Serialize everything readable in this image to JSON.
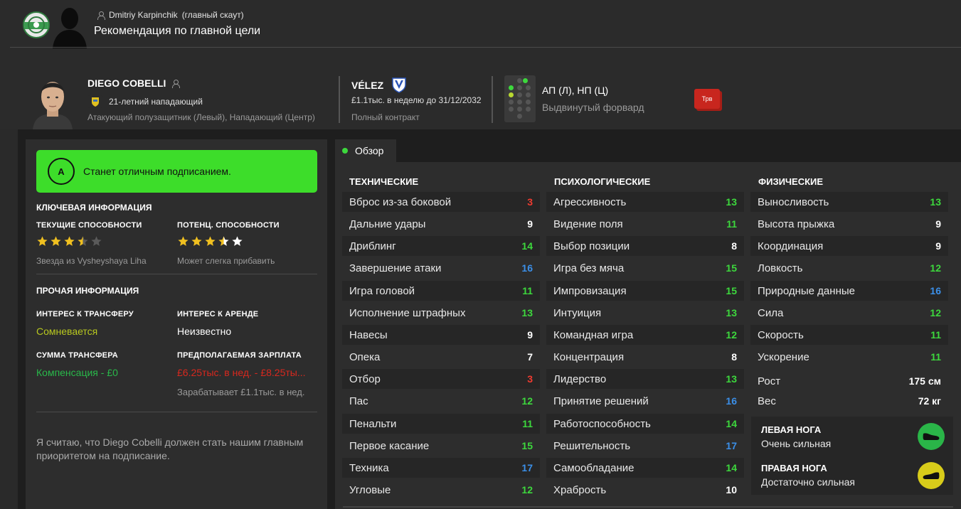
{
  "scout": {
    "name": "Dmitriy Karpinchik",
    "role": "(главный скаут)"
  },
  "page_title": "Рекомендация по главной цели",
  "player": {
    "name": "DIEGO COBELLI",
    "age_line": "21-летний нападающий",
    "positions": "Атакующий полузащитник (Левый), Нападающий (Центр)"
  },
  "club": {
    "name": "VÉLEZ",
    "contract": "£1.1тыс. в неделю до 31/12/2032",
    "contract_type": "Полный контракт"
  },
  "role": {
    "positions": "АП (Л), НП (Ц)",
    "name": "Выдвинутый форвард"
  },
  "injury_badge": "Трв",
  "grade": {
    "letter": "A",
    "text": "Станет отличным подписанием.",
    "color": "#3ddd2a"
  },
  "key_info": {
    "title": "КЛЮЧЕВАЯ ИНФОРМАЦИЯ",
    "current_label": "ТЕКУЩИЕ СПОСОБНОСТИ",
    "current_stars": 3.5,
    "current_note": "Звезда из Vysheyshaya Liha",
    "potential_label": "ПОТЕНЦ. СПОСОБНОСТИ",
    "potential_stars": 3.5,
    "potential_extra_stars": 1,
    "potential_note": "Может слегка прибавить"
  },
  "other_info": {
    "title": "ПРОЧАЯ ИНФОРМАЦИЯ",
    "transfer_interest_label": "ИНТЕРЕС К ТРАНСФЕРУ",
    "transfer_interest_value": "Сомневается",
    "loan_interest_label": "ИНТЕРЕС К АРЕНДЕ",
    "loan_interest_value": "Неизвестно",
    "fee_label": "СУММА ТРАНСФЕРА",
    "fee_value": "Компенсация - £0",
    "wage_label": "ПРЕДПОЛАГАЕМАЯ ЗАРПЛАТА",
    "wage_value": "£6.25тыс. в нед. - £8.25ты...",
    "current_wage": "Зарабатывает £1.1тыс. в нед."
  },
  "comment": "Я считаю, что Diego Cobelli должен стать нашим главным приоритетом на подписание.",
  "tab": {
    "label": "Обзор"
  },
  "columns": {
    "technical": {
      "title": "ТЕХНИЧЕСКИЕ",
      "rows": [
        {
          "name": "Вброс из-за боковой",
          "value": "3",
          "tone": "red"
        },
        {
          "name": "Дальние удары",
          "value": "9",
          "tone": "white"
        },
        {
          "name": "Дриблинг",
          "value": "14",
          "tone": "green"
        },
        {
          "name": "Завершение атаки",
          "value": "16",
          "tone": "blue"
        },
        {
          "name": "Игра головой",
          "value": "11",
          "tone": "green"
        },
        {
          "name": "Исполнение штрафных",
          "value": "13",
          "tone": "green"
        },
        {
          "name": "Навесы",
          "value": "9",
          "tone": "white"
        },
        {
          "name": "Опека",
          "value": "7",
          "tone": "white"
        },
        {
          "name": "Отбор",
          "value": "3",
          "tone": "red"
        },
        {
          "name": "Пас",
          "value": "12",
          "tone": "green"
        },
        {
          "name": "Пенальти",
          "value": "11",
          "tone": "green"
        },
        {
          "name": "Первое касание",
          "value": "15",
          "tone": "green"
        },
        {
          "name": "Техника",
          "value": "17",
          "tone": "blue"
        },
        {
          "name": "Угловые",
          "value": "12",
          "tone": "green"
        }
      ]
    },
    "mental": {
      "title": "ПСИХОЛОГИЧЕСКИЕ",
      "rows": [
        {
          "name": "Агрессивность",
          "value": "13",
          "tone": "green"
        },
        {
          "name": "Видение поля",
          "value": "11",
          "tone": "green"
        },
        {
          "name": "Выбор позиции",
          "value": "8",
          "tone": "white"
        },
        {
          "name": "Игра без мяча",
          "value": "15",
          "tone": "green"
        },
        {
          "name": "Импровизация",
          "value": "15",
          "tone": "green"
        },
        {
          "name": "Интуиция",
          "value": "13",
          "tone": "green"
        },
        {
          "name": "Командная игра",
          "value": "12",
          "tone": "green"
        },
        {
          "name": "Концентрация",
          "value": "8",
          "tone": "white"
        },
        {
          "name": "Лидерство",
          "value": "13",
          "tone": "green"
        },
        {
          "name": "Принятие решений",
          "value": "16",
          "tone": "blue"
        },
        {
          "name": "Работоспособность",
          "value": "14",
          "tone": "green"
        },
        {
          "name": "Решительность",
          "value": "17",
          "tone": "blue"
        },
        {
          "name": "Самообладание",
          "value": "14",
          "tone": "green"
        },
        {
          "name": "Храбрость",
          "value": "10",
          "tone": "white"
        }
      ]
    },
    "physical": {
      "title": "ФИЗИЧЕСКИЕ",
      "rows": [
        {
          "name": "Выносливость",
          "value": "13",
          "tone": "green"
        },
        {
          "name": "Высота прыжка",
          "value": "9",
          "tone": "white"
        },
        {
          "name": "Координация",
          "value": "9",
          "tone": "white"
        },
        {
          "name": "Ловкость",
          "value": "12",
          "tone": "green"
        },
        {
          "name": "Природные данные",
          "value": "16",
          "tone": "blue"
        },
        {
          "name": "Сила",
          "value": "12",
          "tone": "green"
        },
        {
          "name": "Скорость",
          "value": "11",
          "tone": "green"
        },
        {
          "name": "Ускорение",
          "value": "11",
          "tone": "green"
        },
        {
          "name": "Рост",
          "value": "175 см",
          "tone": "white"
        },
        {
          "name": "Вес",
          "value": "72 кг",
          "tone": "white"
        }
      ]
    }
  },
  "feet": {
    "left_label": "ЛЕВАЯ НОГА",
    "left_value": "Очень сильная",
    "right_label": "ПРАВАЯ НОГА",
    "right_value": "Достаточно сильная"
  },
  "icons": [
    "person-icon",
    "club-crest-icon",
    "nation-flag-icon",
    "boot-icon"
  ]
}
